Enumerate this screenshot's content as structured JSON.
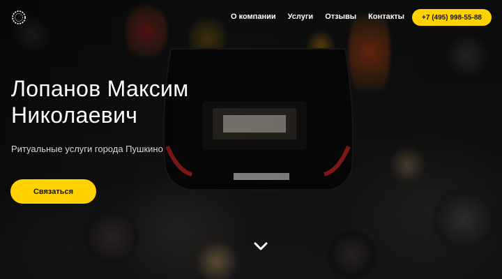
{
  "nav": {
    "items": [
      {
        "label": "О компании"
      },
      {
        "label": "Услуги"
      },
      {
        "label": "Отзывы"
      },
      {
        "label": "Контакты"
      }
    ],
    "phone": "+7 (495) 998-55-88"
  },
  "hero": {
    "title_line1": "Лопанов Максим",
    "title_line2": "Николаевич",
    "subtitle": "Ритуальные услуги города Пушкино",
    "cta_label": "Связаться"
  },
  "colors": {
    "accent": "#ffd200",
    "text": "#ffffff",
    "background": "#0b0b0b"
  },
  "icons": {
    "logo": "wreath-icon",
    "scroll": "chevron-down-icon"
  }
}
